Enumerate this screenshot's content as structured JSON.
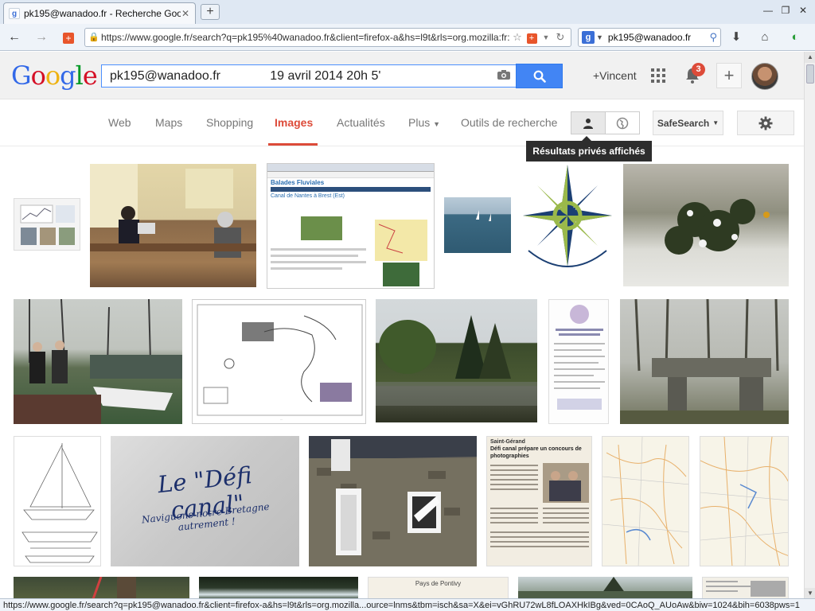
{
  "browser": {
    "tab_title": "pk195@wanadoo.fr - Recherche Google",
    "url": "https://www.google.fr/search?q=pk195%40wanadoo.fr&client=firefox-a&hs=l9t&rls=org.mozilla:fr:off",
    "search_engine_query": "pk195@wanadoo.fr",
    "status_url": "https://www.google.fr/search?q=pk195@wanadoo.fr&client=firefox-a&hs=l9t&rls=org.mozilla...ource=lnms&tbm=isch&sa=X&ei=vGhRU72wL8fLOAXHkIBg&ved=0CAoQ_AUoAw&biw=1024&bih=6038pws=1"
  },
  "google": {
    "logo_letters": [
      "G",
      "o",
      "o",
      "g",
      "l",
      "e"
    ],
    "query": "pk195@wanadoo.fr              19 avril 2014 20h 5'",
    "user_name": "+Vincent",
    "notification_count": "3",
    "share_symbol": "+",
    "tabs": [
      {
        "label": "Web"
      },
      {
        "label": "Maps"
      },
      {
        "label": "Shopping"
      },
      {
        "label": "Images"
      },
      {
        "label": "Actualités"
      },
      {
        "label": "Plus"
      },
      {
        "label": "Outils de recherche"
      }
    ],
    "active_tab": "Images",
    "safesearch_label": "SafeSearch",
    "tooltip": "Résultats privés affichés",
    "accent_color": "#dd4b39",
    "button_color": "#4285f4"
  },
  "images": {
    "row1": [
      "chart-document",
      "office-meeting",
      "canal-website",
      "sea-sailboat",
      "compass-rose",
      "snowy-shrub"
    ],
    "row2": [
      "two-men-canal",
      "canal-map",
      "canal-trees",
      "poster-document",
      "stone-lock"
    ],
    "row3": [
      "boat-plan",
      "defi-canal-sign",
      "stone-house",
      "newspaper-article",
      "map-1",
      "map-2"
    ],
    "row4": [
      "tree-trunk",
      "dark-water",
      "pays-de-pontivy",
      "canal-view",
      "newspaper-2"
    ],
    "sign_text_line1": "Le \"Défi canal\"",
    "sign_text_line2": "Naviguons notre Bretagne autrement !",
    "website_header": "Balades Fluviales",
    "website_subtitle": "Canal de Nantes à Brest (Est)",
    "poster_text_1": "Saint-Gérand",
    "poster_text_2": "Défi canal prépare un concours de photographies",
    "pontivy_text": "Pays de Pontivy"
  }
}
